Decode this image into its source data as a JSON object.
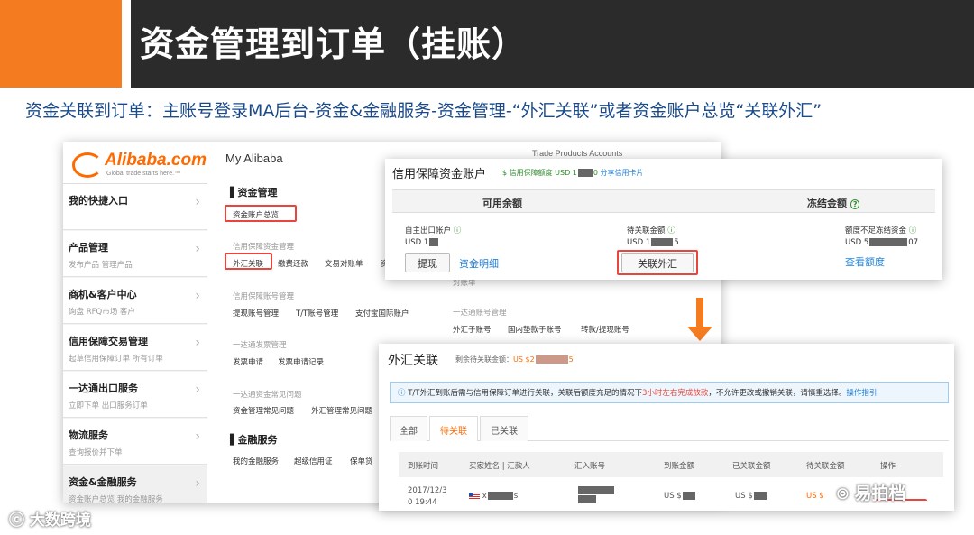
{
  "header": {
    "title": "资金管理到订单（挂账）",
    "subtitle": "资金关联到订单：主账号登录MA后台-资金&金融服务-资金管理-“外汇关联”或者资金账户总览“关联外汇”"
  },
  "left": {
    "logo": "Alibaba.com",
    "logo_tag": "Global trade starts here.™",
    "my_alibaba": "My Alibaba",
    "topbar_right": "Trade  Products  Accounts",
    "sidebar": [
      {
        "title": "我的快捷入口",
        "sub": ""
      },
      {
        "title": "产品管理",
        "sub": "发布产品   管理产品"
      },
      {
        "title": "商机&客户中心",
        "sub": "询盘   RFQ市场   客户"
      },
      {
        "title": "信用保障交易管理",
        "sub": "起草信用保障订单   所有订单"
      },
      {
        "title": "一达通出口服务",
        "sub": "立即下单   出口服务订单"
      },
      {
        "title": "物流服务",
        "sub": "查询报价并下单"
      },
      {
        "title": "资金&金融服务",
        "sub": "资金账户总览   我的金融服务"
      }
    ],
    "sec1": "资金管理",
    "overview": "资金账户总览",
    "grp1": "信用保障资金管理",
    "fx": "外汇关联",
    "pay": "缴费还款",
    "trade_stmt": "交易对账单",
    "zi": "资",
    "grp2": "信用保障账号管理",
    "g2l1": "提现账号管理",
    "g2l2": "T/T账号管理",
    "g2l3": "支付宝国际账户",
    "grp3": "一达通发票管理",
    "g3l1": "发票申请",
    "g3l2": "发票申请记录",
    "grp4": "一达通资金常见问题",
    "g4l1": "资金管理常见问题",
    "g4l2": "外汇管理常见问题",
    "sec2": "金融服务",
    "g5l1": "我的金融服务",
    "g5l2": "超级信用证",
    "g5l3": "保单贷",
    "peek_grp": "一达通账号管理",
    "peek1": "外汇子账号",
    "peek2": "国内垫款子账号",
    "peek3": "转款/提现账号",
    "peek_dz": "对账单"
  },
  "top_popup": {
    "title": "信用保障资金账户",
    "sub_pre": "$ 信用保障额度 USD 1",
    "sub_post": "0",
    "share": "分享信用卡片",
    "col1": "可用余额",
    "col2": "冻结金额",
    "acct": "自主出口帐户",
    "acct_val_pre": "USD 1",
    "withdraw": "提现",
    "detail": "资金明细",
    "pending": "待关联金额",
    "pending_val_pre": "USD 1",
    "pending_val_post": "5",
    "link_fx": "关联外汇",
    "short": "额度不足冻结资金",
    "short_val_pre": "USD 5",
    "short_val_post": "07",
    "view": "查看额度"
  },
  "bottom_popup": {
    "title": "外汇关联",
    "sub_pre": "剩余待关联金额：",
    "sub_val_pre": "US $2",
    "sub_val_post": "5",
    "notice_a": "T/T外汇到账后需与信用保障订单进行关联，关联后额度充足的情况下",
    "notice_red": "3小时左右完成放款",
    "notice_b": "，不允许更改或撤销关联，请慎重选择。",
    "notice_link": "操作指引",
    "tabs": [
      "全部",
      "待关联",
      "已关联"
    ],
    "columns": [
      "到账时间",
      "买家姓名 | 汇款人",
      "汇入账号",
      "到账金额",
      "已关联金额",
      "待关联金额",
      "操作"
    ],
    "row": {
      "date": "2017/12/3",
      "time": "0 19:44",
      "buyer_pre": "x",
      "buyer_post": "s",
      "amt": "US $",
      "linked": "US $",
      "pending": "US $"
    }
  },
  "watermarks": {
    "left": "大数跨境",
    "right": "易拍档"
  }
}
